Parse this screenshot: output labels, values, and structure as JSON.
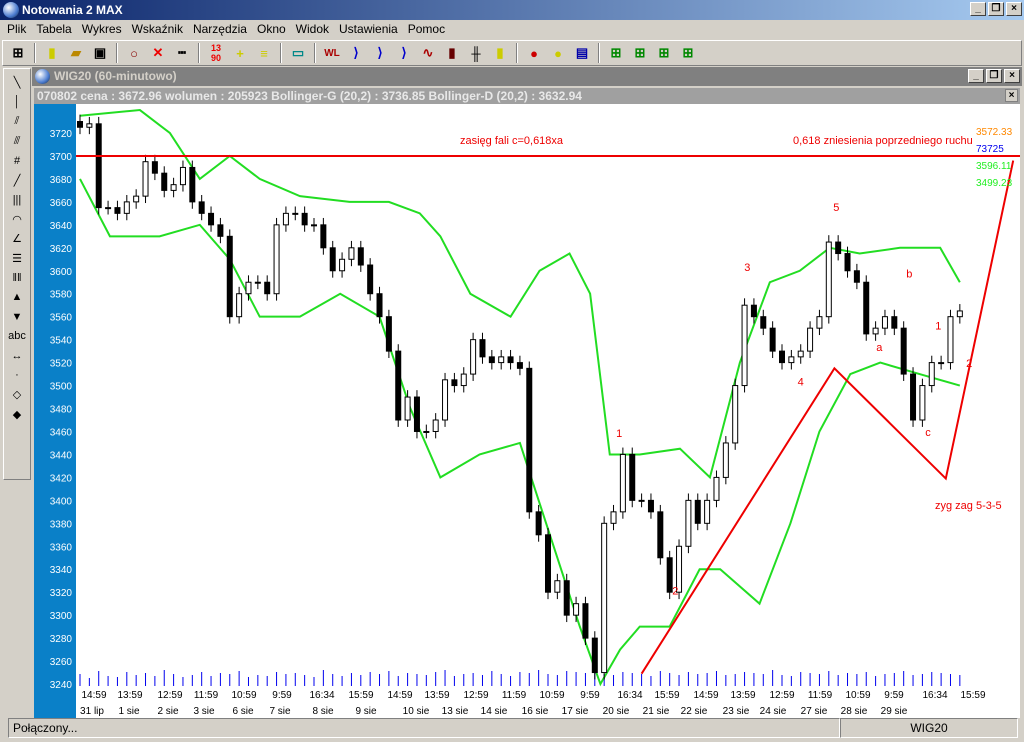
{
  "app": {
    "title": "Notowania 2 MAX"
  },
  "menu": [
    "Plik",
    "Tabela",
    "Wykres",
    "Wskaźnik",
    "Narzędzia",
    "Okno",
    "Widok",
    "Ustawienia",
    "Pomoc"
  ],
  "child": {
    "title": "WIG20 (60-minutowo)",
    "info": "070802  cena : 3672.96 wolumen : 205923 Bollinger-G (20,2) : 3736.85 Bollinger-D (20,2) : 3632.94"
  },
  "status": {
    "left": "Połączony...",
    "right": "WIG20"
  },
  "colors": {
    "axis": "#0a80c8",
    "candle": "#000000",
    "band": "#22dd22",
    "line": "#ee0000",
    "volume": "#0000ee"
  },
  "chart_data": {
    "type": "candlestick",
    "ylim": [
      3240,
      3720
    ],
    "yticks": [
      3720,
      3700,
      3680,
      3660,
      3640,
      3620,
      3600,
      3580,
      3560,
      3540,
      3520,
      3500,
      3480,
      3460,
      3440,
      3420,
      3400,
      3380,
      3360,
      3340,
      3320,
      3300,
      3280,
      3260,
      3240
    ],
    "time_labels": [
      "14:59",
      "13:59",
      "12:59",
      "11:59",
      "10:59",
      "9:59",
      "16:34",
      "15:59",
      "14:59",
      "13:59",
      "12:59",
      "11:59",
      "10:59",
      "9:59",
      "16:34",
      "15:59",
      "14:59",
      "13:59",
      "12:59",
      "11:59",
      "10:59",
      "9:59",
      "16:34",
      "15:59"
    ],
    "date_labels": [
      "31 lip",
      "1 sie",
      "2 sie",
      "3 sie",
      "6 sie",
      "7 sie",
      "8 sie",
      "9 sie",
      "10 sie",
      "13 sie",
      "14 sie",
      "16 sie",
      "17 sie",
      "20 sie",
      "21 sie",
      "22 sie",
      "23 sie",
      "24 sie",
      "27 sie",
      "28 sie",
      "29 sie"
    ],
    "closes": [
      3725,
      3728,
      3655,
      3655,
      3650,
      3660,
      3665,
      3695,
      3685,
      3670,
      3675,
      3690,
      3660,
      3650,
      3640,
      3630,
      3560,
      3580,
      3590,
      3590,
      3580,
      3640,
      3650,
      3650,
      3640,
      3640,
      3620,
      3600,
      3610,
      3620,
      3605,
      3580,
      3560,
      3530,
      3470,
      3490,
      3460,
      3460,
      3470,
      3505,
      3500,
      3510,
      3540,
      3525,
      3520,
      3525,
      3520,
      3515,
      3390,
      3370,
      3320,
      3330,
      3300,
      3310,
      3280,
      3250,
      3380,
      3390,
      3440,
      3400,
      3400,
      3390,
      3350,
      3320,
      3360,
      3400,
      3380,
      3400,
      3420,
      3450,
      3500,
      3570,
      3560,
      3550,
      3530,
      3520,
      3525,
      3530,
      3550,
      3560,
      3625,
      3615,
      3600,
      3590,
      3545,
      3550,
      3560,
      3550,
      3510,
      3470,
      3500,
      3520,
      3520,
      3560,
      3565
    ],
    "volume": [
      12,
      8,
      15,
      10,
      9,
      14,
      11,
      13,
      10,
      16,
      12,
      9,
      11,
      14,
      10,
      13,
      12,
      15,
      9,
      11,
      10,
      14,
      12,
      13,
      11,
      9,
      16,
      12,
      10,
      13,
      11,
      14,
      12,
      15,
      10,
      13,
      12,
      11,
      14,
      16,
      10,
      12,
      13,
      11,
      15,
      12,
      10,
      14,
      13,
      16,
      12,
      11,
      15,
      14,
      13,
      17,
      12,
      11,
      14,
      13,
      12,
      10,
      15,
      13,
      11,
      14,
      12,
      13,
      15,
      11,
      12,
      14,
      13,
      12,
      16,
      11,
      10,
      14,
      13,
      12,
      15,
      11,
      13,
      12,
      14,
      10,
      12,
      13,
      15,
      11,
      12,
      14,
      13,
      12,
      11
    ],
    "bollinger_upper": [
      [
        0,
        3735
      ],
      [
        6.4,
        3740
      ],
      [
        9.6,
        3720
      ],
      [
        12.8,
        3680
      ],
      [
        16,
        3700
      ],
      [
        19.2,
        3680
      ],
      [
        23.5,
        3665
      ],
      [
        28.8,
        3660
      ],
      [
        33,
        3660
      ],
      [
        36.3,
        3650
      ],
      [
        38.5,
        3630
      ],
      [
        41.7,
        3580
      ],
      [
        46,
        3560
      ],
      [
        49.1,
        3600
      ],
      [
        52.3,
        3615
      ],
      [
        54.5,
        3580
      ],
      [
        56.6,
        3440
      ],
      [
        59.8,
        3440
      ],
      [
        64.1,
        3445
      ],
      [
        67.3,
        3420
      ],
      [
        70.5,
        3520
      ],
      [
        73.7,
        3590
      ],
      [
        76.9,
        3600
      ],
      [
        80.1,
        3620
      ],
      [
        83.3,
        3615
      ],
      [
        87.6,
        3620
      ],
      [
        91.9,
        3620
      ],
      [
        94,
        3590
      ]
    ],
    "bollinger_lower": [
      [
        0,
        3680
      ],
      [
        3.2,
        3630
      ],
      [
        8.5,
        3630
      ],
      [
        12.8,
        3640
      ],
      [
        16,
        3610
      ],
      [
        19.2,
        3560
      ],
      [
        23.5,
        3560
      ],
      [
        27.8,
        3580
      ],
      [
        32,
        3560
      ],
      [
        35.3,
        3480
      ],
      [
        38.5,
        3420
      ],
      [
        42.7,
        3440
      ],
      [
        47,
        3450
      ],
      [
        50.2,
        3370
      ],
      [
        53.4,
        3290
      ],
      [
        55.6,
        3240
      ],
      [
        57.7,
        3270
      ],
      [
        59.8,
        3290
      ],
      [
        63,
        3290
      ],
      [
        66.2,
        3340
      ],
      [
        68.4,
        3340
      ],
      [
        72.6,
        3310
      ],
      [
        75.9,
        3380
      ],
      [
        79,
        3460
      ],
      [
        82.3,
        3510
      ],
      [
        85.5,
        3520
      ],
      [
        89.7,
        3510
      ],
      [
        94,
        3500
      ]
    ],
    "zigzag": [
      [
        60,
        3249
      ],
      [
        80.6,
        3515
      ],
      [
        92.5,
        3419
      ],
      [
        99.7,
        3696
      ]
    ],
    "hline": 3700,
    "wave_labels": [
      {
        "t": "1",
        "i": 57.6,
        "p": 3455
      },
      {
        "t": "2",
        "i": 63.6,
        "p": 3318
      },
      {
        "t": "3",
        "i": 71.3,
        "p": 3600
      },
      {
        "t": "4",
        "i": 77,
        "p": 3500
      },
      {
        "t": "5",
        "i": 80.8,
        "p": 3652
      },
      {
        "t": "a",
        "i": 85.4,
        "p": 3530
      },
      {
        "t": "b",
        "i": 88.6,
        "p": 3594
      },
      {
        "t": "c",
        "i": 90.6,
        "p": 3456
      },
      {
        "t": "1",
        "i": 91.7,
        "p": 3549
      },
      {
        "t": "2",
        "i": 95,
        "p": 3516
      }
    ],
    "annotations": {
      "zasieg": "zasięg fali c=0,618xa",
      "zniesienie": "0,618 zniesienia poprzedniego ruchu",
      "zygzag": "zyg zag 5-3-5"
    },
    "right_values": [
      {
        "v": "3572.33",
        "c": "#ff8800"
      },
      {
        "v": "73725",
        "c": "#0000ee"
      },
      {
        "v": "3596.11",
        "c": "#22ee22"
      },
      {
        "v": "3499.23",
        "c": "#22ee22"
      }
    ]
  }
}
